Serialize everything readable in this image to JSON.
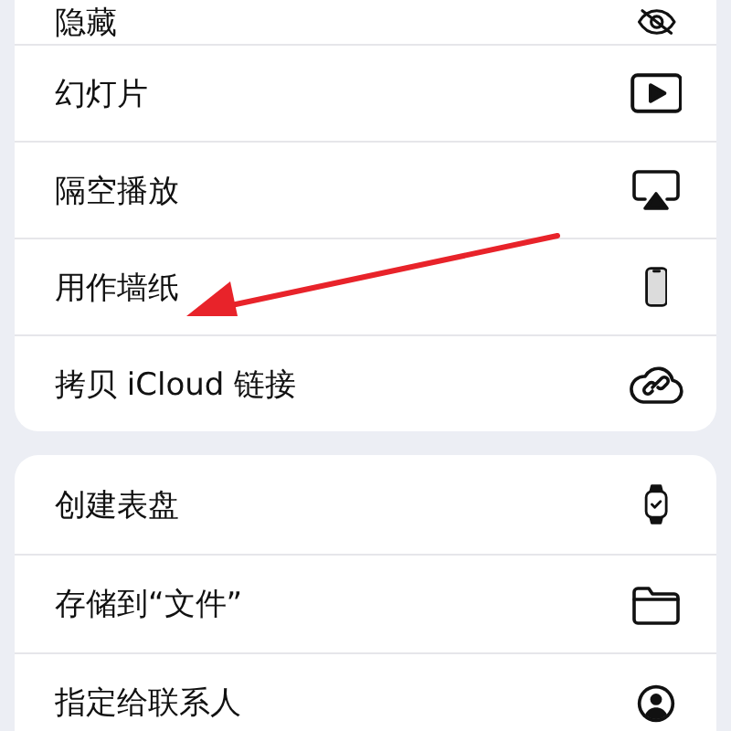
{
  "groups": [
    {
      "items": [
        {
          "label": "隐藏"
        },
        {
          "label": "幻灯片"
        },
        {
          "label": "隔空播放"
        },
        {
          "label": "用作墙纸"
        },
        {
          "label": "拷贝 iCloud 链接"
        }
      ]
    },
    {
      "items": [
        {
          "label": "创建表盘"
        },
        {
          "label": "存储到“文件”"
        },
        {
          "label": "指定给联系人"
        }
      ]
    }
  ]
}
